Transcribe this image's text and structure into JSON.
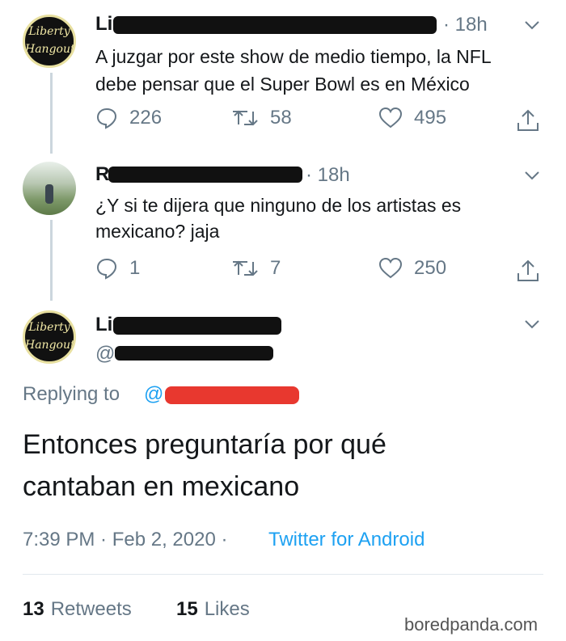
{
  "tweet1": {
    "name": "Li",
    "time": "· 18h",
    "line1": "A juzgar por este show de medio tiempo, la NFL",
    "line2": "debe pensar que el Super Bowl es en México",
    "replies": "226",
    "retweets": "58",
    "likes": "495",
    "avatar_text_top": "Liberty",
    "avatar_text_bottom": "Hangout"
  },
  "tweet2": {
    "name": "R",
    "time": "· 18h",
    "line1": "¿Y si te dijera que ninguno de los artistas es",
    "line2": "mexicano? jaja",
    "replies": "1",
    "retweets": "7",
    "likes": "250"
  },
  "main_tweet": {
    "name": "Li",
    "handle": "@",
    "replying_to_label": "Replying to",
    "replying_handle": "@",
    "line1": "Entonces preguntaría por qué",
    "line2": "cantaban en mexicano",
    "timestamp": "7:39 PM · Feb 2, 2020 ·",
    "source": "Twitter for Android",
    "retweets_count": "13",
    "retweets_label": "Retweets",
    "likes_count": "15",
    "likes_label": "Likes",
    "avatar_text_top": "Liberty",
    "avatar_text_bottom": "Hangout"
  },
  "watermark": "boredpanda.com",
  "colors": {
    "link": "#1da1f2",
    "muted": "#657786",
    "redaction": "#111111",
    "redaction_red": "#e8382f"
  }
}
